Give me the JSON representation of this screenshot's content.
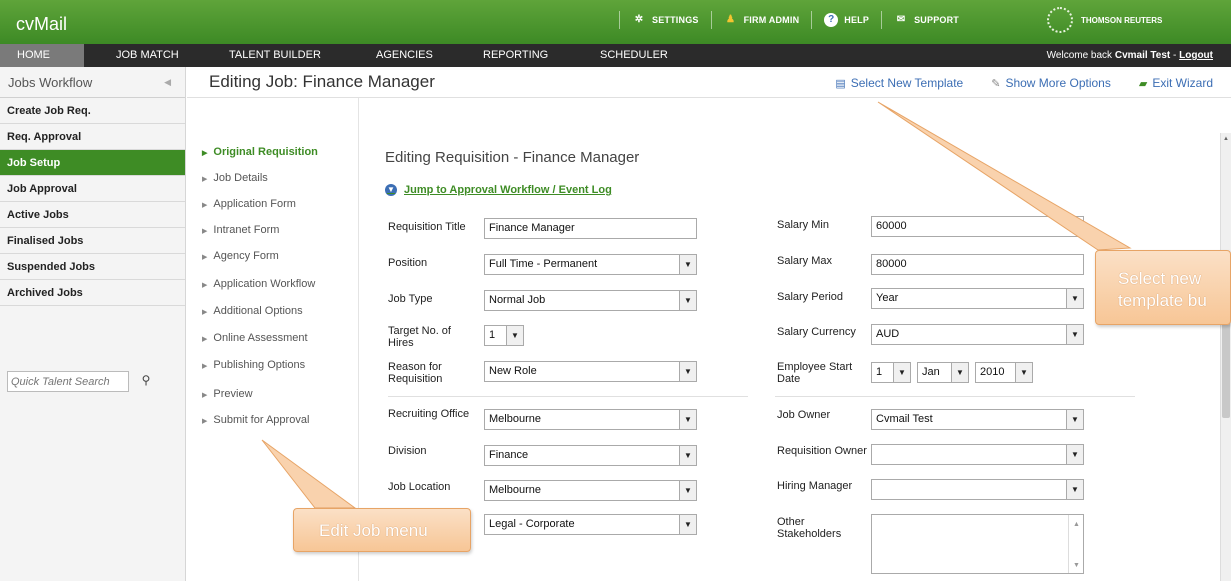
{
  "app": {
    "logo": "cvMail",
    "brand": "THOMSON REUTERS"
  },
  "topnav": {
    "settings": "SETTINGS",
    "firmadmin": "FIRM ADMIN",
    "help": "HELP",
    "support": "SUPPORT"
  },
  "mainnav": {
    "tabs": [
      {
        "label": "HOME"
      },
      {
        "label": "JOB MATCH"
      },
      {
        "label": "TALENT BUILDER"
      },
      {
        "label": "AGENCIES"
      },
      {
        "label": "REPORTING"
      },
      {
        "label": "SCHEDULER"
      }
    ],
    "welcome_prefix": "Welcome back",
    "welcome_user": "Cvmail Test",
    "welcome_sep": " - ",
    "logout": "Logout"
  },
  "sidebar": {
    "title": "Jobs Workflow",
    "items": [
      {
        "label": "Create Job Req."
      },
      {
        "label": "Req. Approval"
      },
      {
        "label": "Job Setup"
      },
      {
        "label": "Job Approval"
      },
      {
        "label": "Active Jobs"
      },
      {
        "label": "Finalised Jobs"
      },
      {
        "label": "Suspended Jobs"
      },
      {
        "label": "Archived Jobs"
      }
    ],
    "search_placeholder": "Quick Talent Search"
  },
  "header": {
    "title": "Editing Job: Finance Manager",
    "select_template": "Select New Template",
    "more_options": "Show More Options",
    "exit_wizard": "Exit Wizard"
  },
  "wizard": {
    "items": [
      {
        "label": "Original Requisition"
      },
      {
        "label": "Job Details"
      },
      {
        "label": "Application Form"
      },
      {
        "label": "Intranet Form"
      },
      {
        "label": "Agency Form"
      },
      {
        "label": "Application Workflow"
      },
      {
        "label": "Additional Options"
      },
      {
        "label": "Online Assessment"
      },
      {
        "label": "Publishing Options"
      },
      {
        "label": "Preview"
      },
      {
        "label": "Submit for Approval"
      }
    ]
  },
  "form": {
    "heading": "Editing Requisition - Finance Manager",
    "jump_link": "Jump to Approval Workflow / Event Log",
    "requisition_title": {
      "label": "Requisition Title",
      "value": "Finance Manager"
    },
    "position": {
      "label": "Position",
      "value": "Full Time - Permanent"
    },
    "job_type": {
      "label": "Job Type",
      "value": "Normal Job"
    },
    "target_hires": {
      "label_1": "Target No. of",
      "label_2": "Hires",
      "value": "1"
    },
    "reason": {
      "label_1": "Reason for",
      "label_2": "Requisition",
      "value": "New Role"
    },
    "recruiting_office": {
      "label": "Recruiting Office",
      "value": "Melbourne"
    },
    "division": {
      "label": "Division",
      "value": "Finance"
    },
    "job_location": {
      "label": "Job Location",
      "value": "Melbourne"
    },
    "practice_area": {
      "value": "Legal - Corporate"
    },
    "salary_min": {
      "label": "Salary Min",
      "value": "60000"
    },
    "salary_max": {
      "label": "Salary Max",
      "value": "80000"
    },
    "salary_period": {
      "label": "Salary Period",
      "value": "Year"
    },
    "salary_currency": {
      "label": "Salary Currency",
      "value": "AUD"
    },
    "start_date": {
      "label_1": "Employee Start",
      "label_2": "Date",
      "day": "1",
      "month": "Jan",
      "year": "2010"
    },
    "job_owner": {
      "label": "Job Owner",
      "value": "Cvmail Test"
    },
    "requisition_owner": {
      "label": "Requisition Owner",
      "value": ""
    },
    "hiring_manager": {
      "label": "Hiring Manager",
      "value": ""
    },
    "other_stakeholders": {
      "label_1": "Other",
      "label_2": "Stakeholders"
    }
  },
  "callouts": {
    "template": {
      "line1": "Select new",
      "line2": "template bu"
    },
    "edit_menu": "Edit Job menu"
  }
}
